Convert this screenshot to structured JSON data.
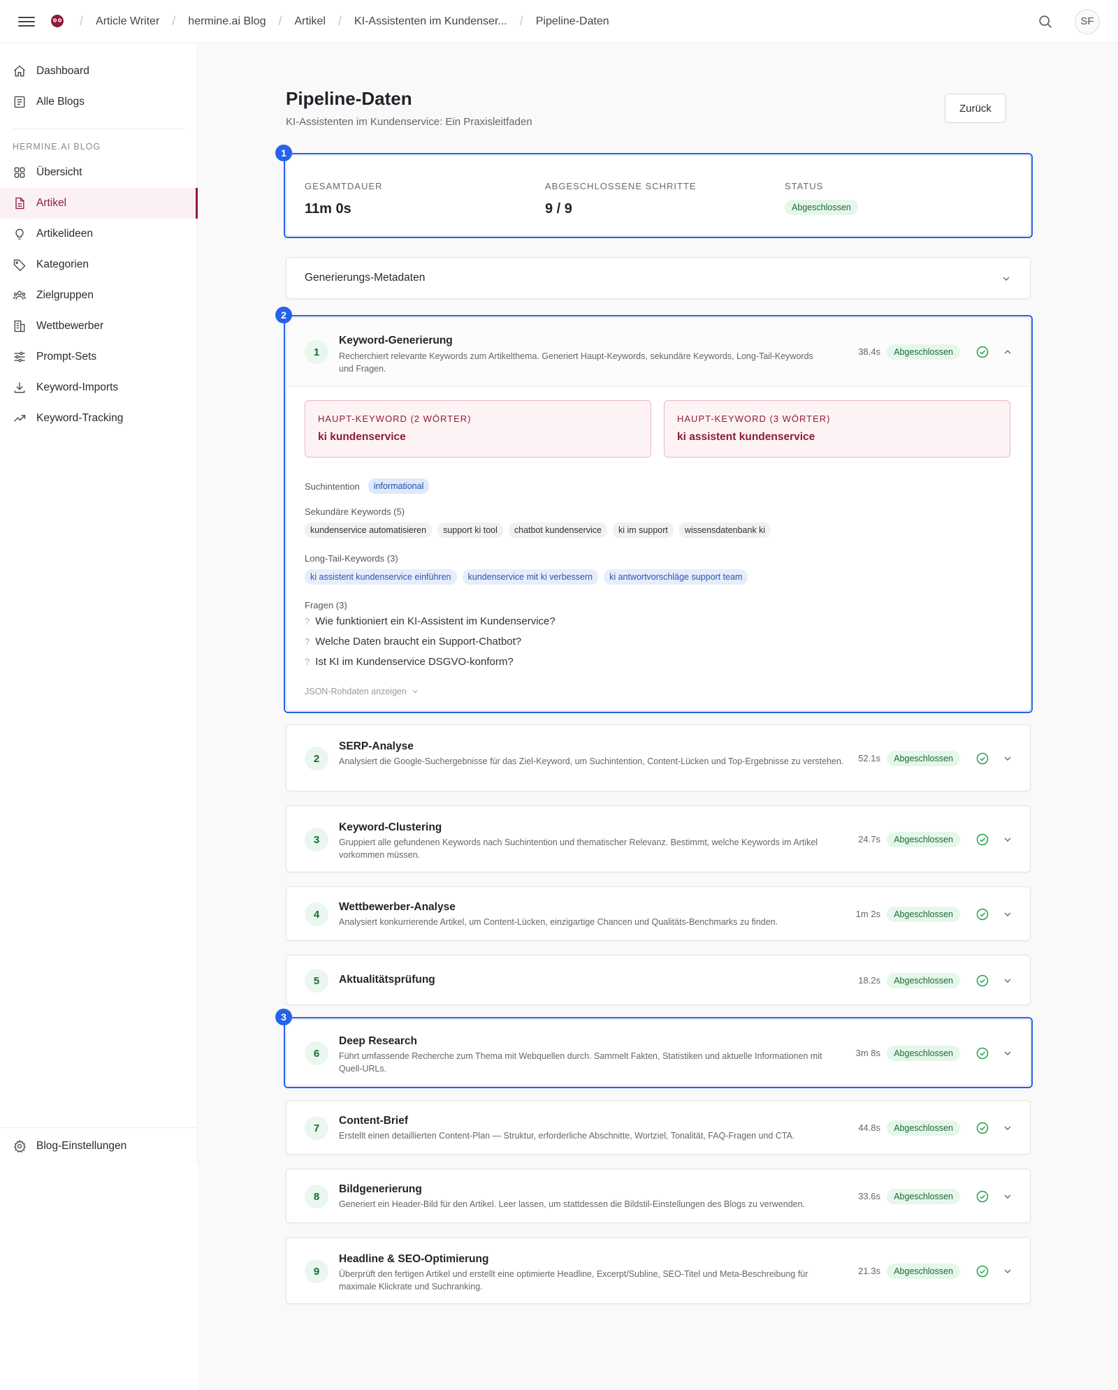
{
  "topbar": {
    "breadcrumbs": [
      "Article Writer",
      "hermine.ai Blog",
      "Artikel",
      "KI-Assistenten im Kundenser...",
      "Pipeline-Daten"
    ],
    "avatar_initials": "SF"
  },
  "sidebar": {
    "top_items": [
      {
        "label": "Dashboard",
        "icon": "home-icon"
      },
      {
        "label": "Alle Blogs",
        "icon": "blogs-icon"
      }
    ],
    "section_title": "HERMINE.AI BLOG",
    "items": [
      {
        "label": "Übersicht",
        "icon": "grid-icon"
      },
      {
        "label": "Artikel",
        "icon": "document-icon",
        "active": true
      },
      {
        "label": "Artikelideen",
        "icon": "lightbulb-icon"
      },
      {
        "label": "Kategorien",
        "icon": "tag-icon"
      },
      {
        "label": "Zielgruppen",
        "icon": "users-icon"
      },
      {
        "label": "Wettbewerber",
        "icon": "building-icon"
      },
      {
        "label": "Prompt-Sets",
        "icon": "sliders-icon"
      },
      {
        "label": "Keyword-Imports",
        "icon": "download-icon"
      },
      {
        "label": "Keyword-Tracking",
        "icon": "trending-icon"
      }
    ],
    "settings_label": "Blog-Einstellungen"
  },
  "page": {
    "title": "Pipeline-Daten",
    "subtitle": "KI-Assistenten im Kundenservice: Ein Praxisleitfaden",
    "back_label": "Zurück"
  },
  "markers": [
    "1",
    "2",
    "3"
  ],
  "summary": {
    "duration_label": "GESAMTDAUER",
    "duration_value": "11m 0s",
    "steps_label": "ABGESCHLOSSENE SCHRITTE",
    "steps_value": "9 / 9",
    "status_label": "STATUS",
    "status_value": "Abgeschlossen"
  },
  "metadata_title": "Generierungs-Metadaten",
  "status_label": "Abgeschlossen",
  "steps": [
    {
      "num": "1",
      "title": "Keyword-Generierung",
      "desc": "Recherchiert relevante Keywords zum Artikelthema. Generiert Haupt-Keywords, sekundäre Keywords, Long-Tail-Keywords und Fragen.",
      "duration": "38.4s"
    },
    {
      "num": "2",
      "title": "SERP-Analyse",
      "desc": "Analysiert die Google-Suchergebnisse für das Ziel-Keyword, um Suchintention, Content-Lücken und Top-Ergebnisse zu verstehen.",
      "duration": "52.1s"
    },
    {
      "num": "3",
      "title": "Keyword-Clustering",
      "desc": "Gruppiert alle gefundenen Keywords nach Suchintention und thematischer Relevanz. Bestimmt, welche Keywords im Artikel vorkommen müssen.",
      "duration": "24.7s"
    },
    {
      "num": "4",
      "title": "Wettbewerber-Analyse",
      "desc": "Analysiert konkurrierende Artikel, um Content-Lücken, einzigartige Chancen und Qualitäts-Benchmarks zu finden.",
      "duration": "1m 2s"
    },
    {
      "num": "5",
      "title": "Aktualitätsprüfung",
      "desc": "",
      "duration": "18.2s"
    },
    {
      "num": "6",
      "title": "Deep Research",
      "desc": "Führt umfassende Recherche zum Thema mit Webquellen durch. Sammelt Fakten, Statistiken und aktuelle Informationen mit Quell-URLs.",
      "duration": "3m 8s"
    },
    {
      "num": "7",
      "title": "Content-Brief",
      "desc": "Erstellt einen detaillierten Content-Plan — Struktur, erforderliche Abschnitte, Wortziel, Tonalität, FAQ-Fragen und CTA.",
      "duration": "44.8s"
    },
    {
      "num": "8",
      "title": "Bildgenerierung",
      "desc": "Generiert ein Header-Bild für den Artikel. Leer lassen, um stattdessen die Bildstil-Einstellungen des Blogs zu verwenden.",
      "duration": "33.6s"
    },
    {
      "num": "9",
      "title": "Headline & SEO-Optimierung",
      "desc": "Überprüft den fertigen Artikel und erstellt eine optimierte Headline, Excerpt/Subline, SEO-Titel und Meta-Beschreibung für maximale Klickrate und Suchranking.",
      "duration": "21.3s"
    }
  ],
  "keyword_details": {
    "main2_label": "HAUPT-KEYWORD (2 WÖRTER)",
    "main2_value": "ki kundenservice",
    "main3_label": "HAUPT-KEYWORD (3 WÖRTER)",
    "main3_value": "ki assistent kundenservice",
    "intent_label": "Suchintention",
    "intent_value": "informational",
    "secondary_label": "Sekundäre Keywords (5)",
    "secondary": [
      "kundenservice automatisieren",
      "support ki tool",
      "chatbot kundenservice",
      "ki im support",
      "wissensdatenbank ki"
    ],
    "longtail_label": "Long-Tail-Keywords (3)",
    "longtail": [
      "ki assistent kundenservice einführen",
      "kundenservice mit ki verbessern",
      "ki antwortvorschläge support team"
    ],
    "questions_label": "Fragen (3)",
    "questions": [
      "Wie funktioniert ein KI-Assistent im Kundenservice?",
      "Welche Daten braucht ein Support-Chatbot?",
      "Ist KI im Kundenservice DSGVO-konform?"
    ],
    "question_mark": "?",
    "json_link": "JSON-Rohdaten anzeigen"
  },
  "colors": {
    "accent": "#8c1d3b",
    "highlight": "#2563eb",
    "success": "#1d6b35",
    "success_bg": "#e5f6ea"
  }
}
